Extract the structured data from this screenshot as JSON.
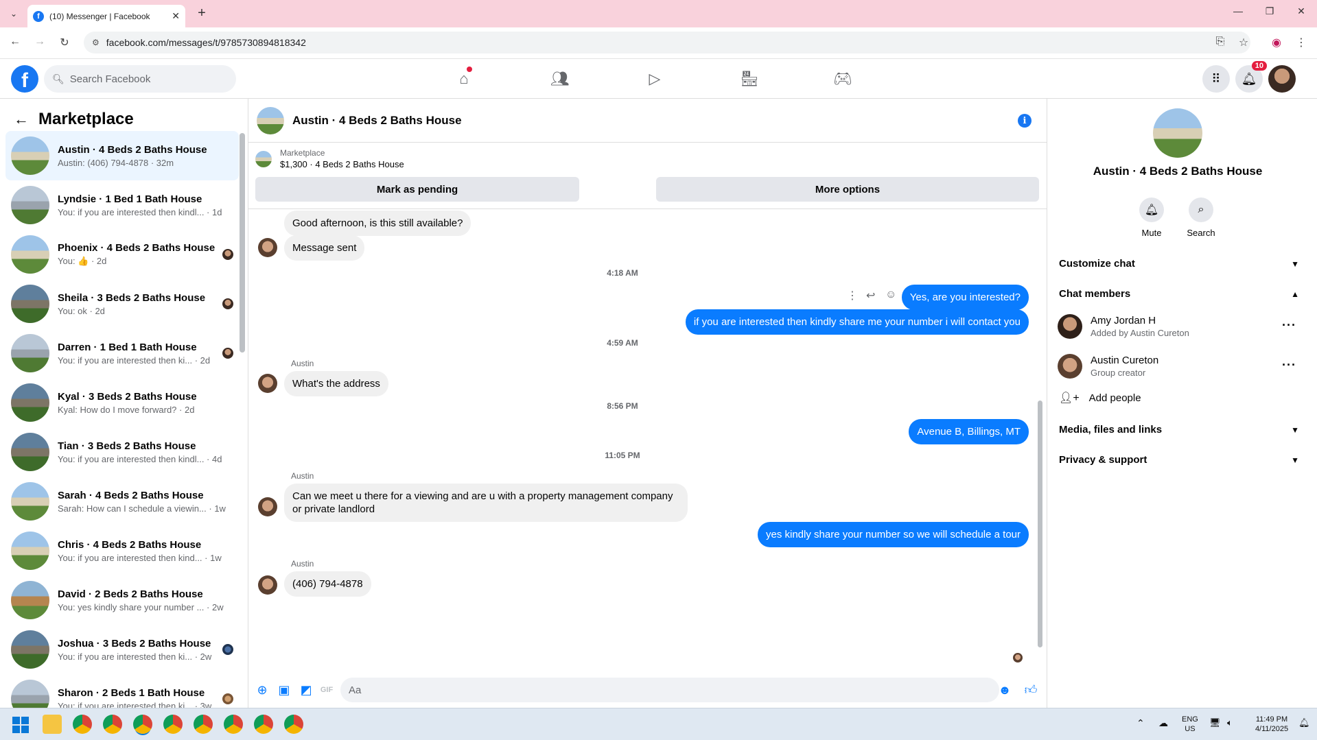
{
  "browser": {
    "tab_title": "(10) Messenger | Facebook",
    "tab_icon": "f",
    "url": "facebook.com/messages/t/9785730894818342"
  },
  "fb": {
    "search_placeholder": "Search Facebook",
    "logo": "f",
    "notifications_count": "10"
  },
  "sidebar": {
    "title": "Marketplace",
    "conversations": [
      {
        "name": "Austin · 4 Beds 2 Baths House",
        "preview": "Austin: (406) 794-4878 · 32m",
        "active": true
      },
      {
        "name": "Lyndsie · 1 Bed 1 Bath House",
        "preview": "You: if you are interested then kindl... · 1d"
      },
      {
        "name": "Phoenix · 4 Beds 2 Baths House",
        "preview": "You: 👍 · 2d"
      },
      {
        "name": "Sheila · 3 Beds 2 Baths House",
        "preview": "You: ok · 2d"
      },
      {
        "name": "Darren · 1 Bed 1 Bath House",
        "preview": "You: if you are interested then ki... · 2d"
      },
      {
        "name": "Kyal · 3 Beds 2 Baths House",
        "preview": "Kyal: How do I move forward? · 2d"
      },
      {
        "name": "Tian · 3 Beds 2 Baths House",
        "preview": "You: if you are interested then kindl... · 4d"
      },
      {
        "name": "Sarah · 4 Beds 2 Baths House",
        "preview": "Sarah: How can I schedule a viewin... · 1w"
      },
      {
        "name": "Chris · 4 Beds 2 Baths House",
        "preview": "You: if you are interested then kind... · 1w"
      },
      {
        "name": "David · 2 Beds 2 Baths House",
        "preview": "You: yes kindly share your number ... · 2w"
      },
      {
        "name": "Joshua · 3 Beds 2 Baths House",
        "preview": "You: if you are interested then ki... · 2w"
      },
      {
        "name": "Sharon · 2 Beds 1 Bath House",
        "preview": "You: if you are interested then ki... · 3w"
      }
    ]
  },
  "chat": {
    "title": "Austin · 4 Beds 2 Baths House",
    "listing_source": "Marketplace",
    "listing_info": "$1,300 · 4 Beds 2 Baths House",
    "btn_pending": "Mark as pending",
    "btn_more": "More options",
    "messages": {
      "m1": "Good afternoon, is this still available?",
      "m2": "Message sent",
      "ts1": "4:18 AM",
      "m3": "Yes, are you interested?",
      "m4": "if you are interested then kindly share me your number i will contact you",
      "ts2": "4:59 AM",
      "sender": "Austin",
      "m5": "What's the address",
      "ts3": "8:56 PM",
      "m6": "Avenue B, Billings, MT",
      "ts4": "11:05 PM",
      "m7": "Can we meet u there for a viewing and are u with a property management company or private landlord",
      "m8": "yes kindly share your number so we will schedule a tour",
      "m9": "(406) 794-4878"
    },
    "composer_placeholder": "Aa"
  },
  "info_panel": {
    "title": "Austin · 4 Beds 2 Baths House",
    "mute_label": "Mute",
    "search_label": "Search",
    "customize_chat": "Customize chat",
    "chat_members": "Chat members",
    "members": [
      {
        "name": "Amy Jordan H",
        "role": "Added by Austin Cureton"
      },
      {
        "name": "Austin Cureton",
        "role": "Group creator"
      }
    ],
    "add_people": "Add people",
    "media": "Media, files and links",
    "privacy": "Privacy & support"
  },
  "taskbar": {
    "lang": "ENG",
    "region": "US",
    "time": "11:49 PM",
    "date": "4/11/2025"
  },
  "colors": {
    "fb_blue": "#1877f2",
    "bubble_out": "#0a7cff",
    "bubble_in": "#f0f0f0",
    "chrome_titlebar": "#f9d2dc"
  }
}
